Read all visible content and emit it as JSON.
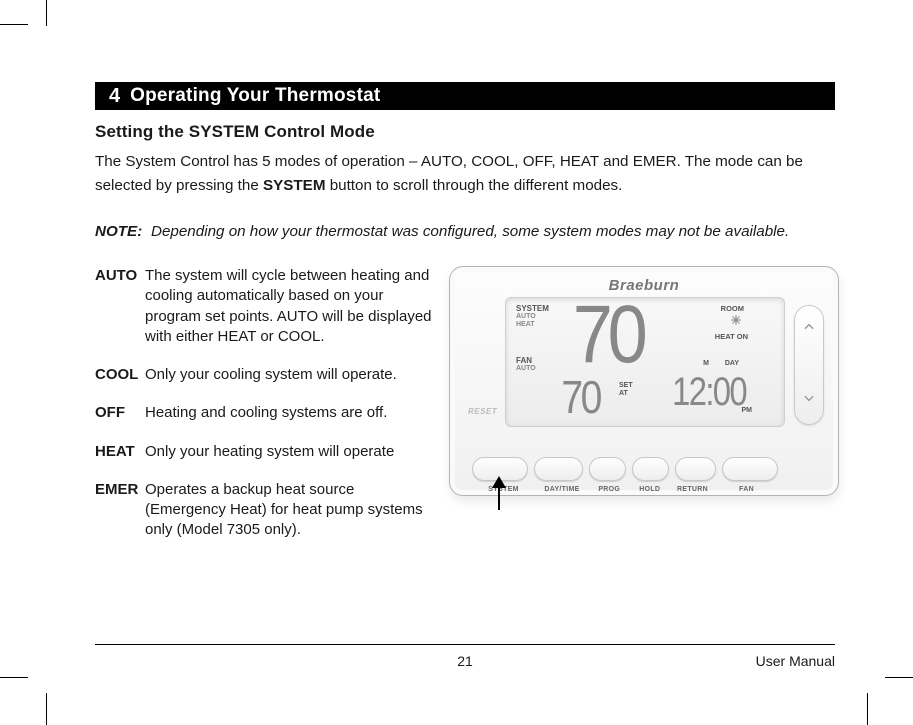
{
  "section": {
    "number": "4",
    "title": "Operating Your Thermostat"
  },
  "heading": "Setting the SYSTEM Control Mode",
  "intro_a": "The System Control has 5 modes of operation – AUTO, COOL, OFF, HEAT and EMER. The mode can be selected by pressing the ",
  "intro_bold": "SYSTEM",
  "intro_b": " button to scroll through the different modes.",
  "note_label": "NOTE:",
  "note_text": "Depending on how your thermostat was configured, some system modes may not be available.",
  "modes": [
    {
      "term": "AUTO",
      "desc": "The system will cycle between heating and cooling automatically based on your program set points. AUTO will be displayed with either HEAT or COOL."
    },
    {
      "term": "COOL",
      "desc": "Only your cooling system will operate."
    },
    {
      "term": "OFF",
      "desc": "Heating and cooling systems are off."
    },
    {
      "term": "HEAT",
      "desc": "Only your heating system will operate"
    },
    {
      "term": "EMER",
      "desc": "Operates a backup heat source (Emergency Heat) for heat pump systems only (Model 7305 only)."
    }
  ],
  "device": {
    "brand": "Braeburn",
    "reset": "RESET",
    "lcd": {
      "system_label": "SYSTEM",
      "system_auto": "AUTO",
      "system_heat": "HEAT",
      "fan_label": "FAN",
      "fan_mode": "AUTO",
      "room_label": "ROOM",
      "heat_on": "HEAT ON",
      "m_label": "M",
      "day_label": "DAY",
      "big_temp": "70",
      "set_temp": "70",
      "set_at": "SET\nAT",
      "clock": "12:00",
      "pm": "PM"
    },
    "buttons": {
      "b1": "SYSTEM",
      "b2": "DAY/TIME",
      "b3": "PROG",
      "b4": "HOLD",
      "b5": "RETURN",
      "b6": "FAN"
    }
  },
  "footer": {
    "page": "21",
    "doc": "User Manual"
  }
}
